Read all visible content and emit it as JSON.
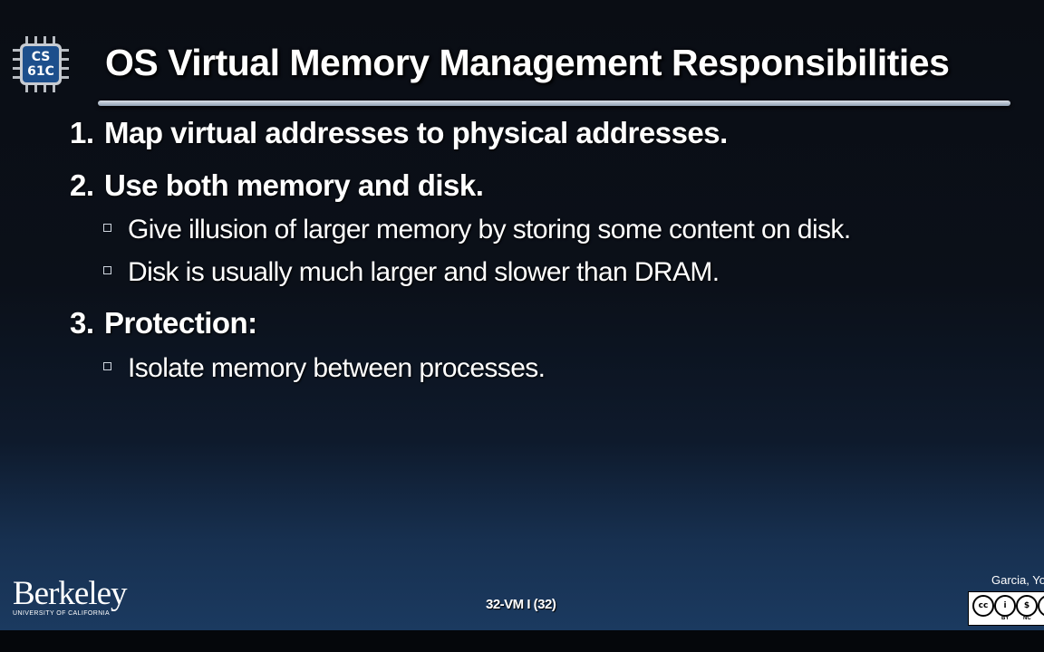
{
  "slide": {
    "logo": {
      "line1": "CS",
      "line2": "61C"
    },
    "title": "OS Virtual Memory Management Responsibilities",
    "items": [
      {
        "num": "1.",
        "text": "Map virtual addresses to physical addresses."
      },
      {
        "num": "2.",
        "text": "Use both memory and disk."
      },
      {
        "num": "3.",
        "text": "Protection:"
      }
    ],
    "subitems": [
      "Give illusion of larger memory by storing some content on disk.",
      "Disk is usually much larger and slower than DRAM.",
      "Isolate memory between processes."
    ]
  },
  "footer": {
    "institution": "Berkeley",
    "institution_sub": "UNIVERSITY OF CALIFORNIA",
    "lecture": "32-VM I (32)",
    "author": "Garcia, Yo",
    "license": {
      "cc": "cc",
      "by": "BY",
      "nc": "NC",
      "sa": "S"
    }
  },
  "colors": {
    "title_rule": "#c9d2dd",
    "logo_chip": "#1d4f8c"
  }
}
